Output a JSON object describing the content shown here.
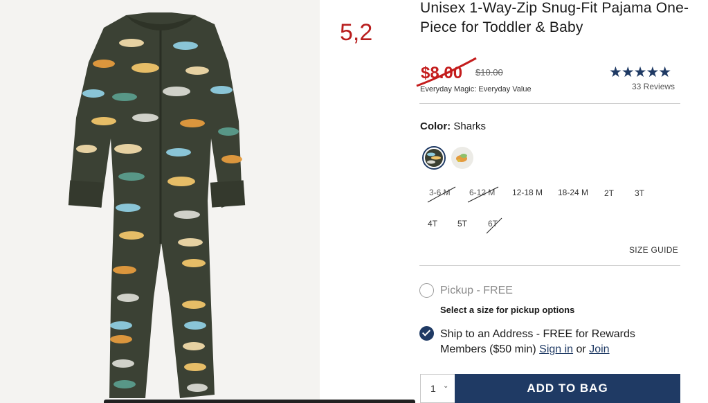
{
  "product": {
    "title": "Unisex 1-Way-Zip Snug-Fit Pajama One-Piece for Toddler & Baby",
    "annotation": "5,2",
    "price": {
      "sale": "$8.00",
      "original": "$10.00",
      "note": "Everyday Magic: Everyday Value"
    },
    "rating": {
      "stars": "★★★★★",
      "reviews": "33 Reviews"
    }
  },
  "color": {
    "label": "Color:",
    "value": "Sharks"
  },
  "sizes": {
    "row1": [
      {
        "label": "3-6 M",
        "available": false
      },
      {
        "label": "6-12 M",
        "available": false
      },
      {
        "label": "12-18 M",
        "available": true
      },
      {
        "label": "18-24 M",
        "available": true
      },
      {
        "label": "2T",
        "available": true
      },
      {
        "label": "3T",
        "available": true
      }
    ],
    "row2": [
      {
        "label": "4T",
        "available": true
      },
      {
        "label": "5T",
        "available": true
      },
      {
        "label": "6T",
        "available": false
      }
    ],
    "guide": "SIZE GUIDE"
  },
  "fulfillment": {
    "pickup_label": "Pickup - FREE",
    "pickup_note": "Select a size for pickup options",
    "ship_text": "Ship to an Address - FREE for Rewards Members ($50 min)",
    "sign_in": "Sign in",
    "or": "or",
    "join": "Join"
  },
  "cart": {
    "quantity": "1",
    "add_label": "ADD TO BAG"
  },
  "colors": {
    "navy": "#1f3a64",
    "sale_red": "#c41d1d"
  }
}
